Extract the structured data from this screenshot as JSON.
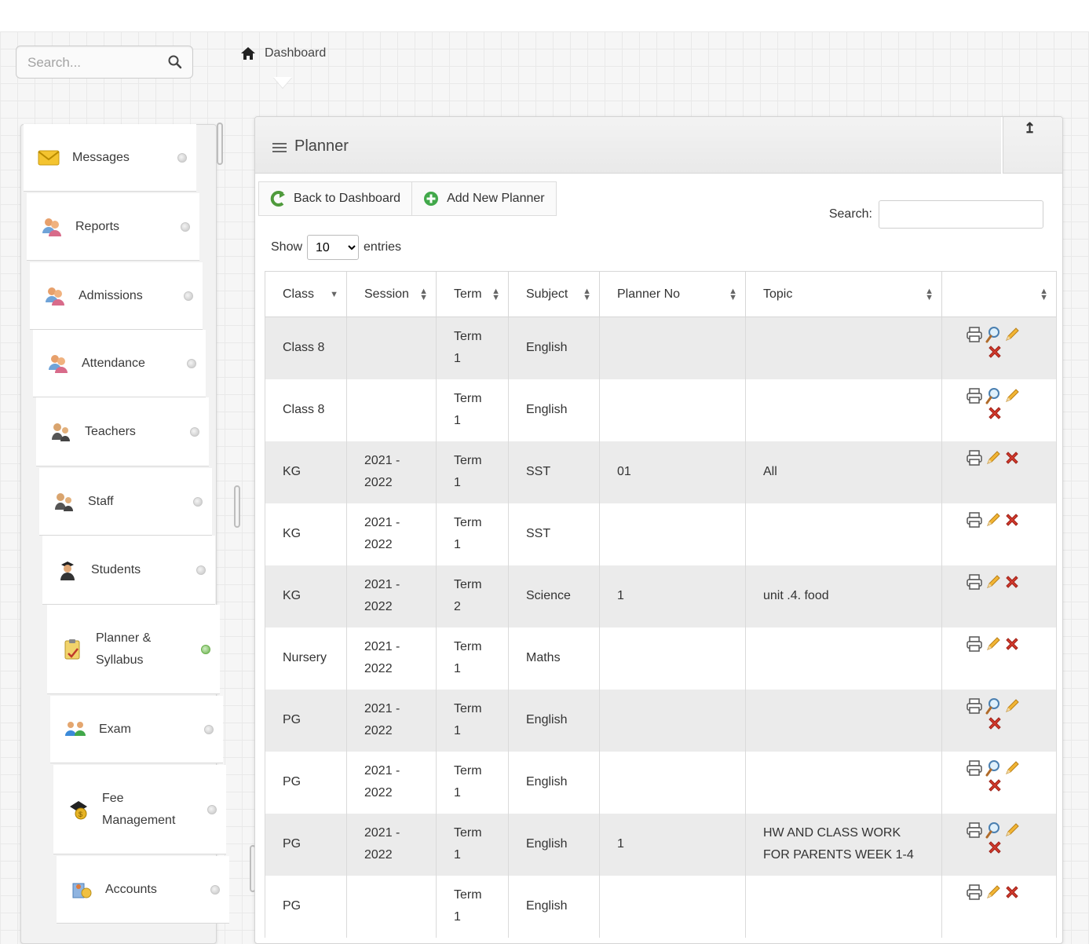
{
  "search": {
    "placeholder": "Search..."
  },
  "breadcrumb": {
    "label": "Dashboard"
  },
  "sidebar": {
    "items": [
      {
        "label": "Messages",
        "icon": "envelope-icon",
        "active": false
      },
      {
        "label": "Reports",
        "icon": "users-icon",
        "active": false
      },
      {
        "label": "Admissions",
        "icon": "users-icon",
        "active": false
      },
      {
        "label": "Attendance",
        "icon": "users-icon",
        "active": false
      },
      {
        "label": "Teachers",
        "icon": "teacher-icon",
        "active": false
      },
      {
        "label": "Staff",
        "icon": "teacher-icon",
        "active": false
      },
      {
        "label": "Students",
        "icon": "student-icon",
        "active": false
      },
      {
        "label": "Planner & Syllabus",
        "icon": "clipboard-icon",
        "active": true
      },
      {
        "label": "Exam",
        "icon": "group-icon",
        "active": false
      },
      {
        "label": "Fee Management",
        "icon": "money-icon",
        "active": false
      },
      {
        "label": "Accounts",
        "icon": "accounts-icon",
        "active": false
      }
    ]
  },
  "panel": {
    "title": "Planner",
    "back_label": "Back to Dashboard",
    "add_label": "Add New Planner",
    "show_label": "Show",
    "entries_label": "entries",
    "page_length": "10",
    "search_label": "Search:"
  },
  "table": {
    "columns": [
      "Class",
      "Session",
      "Term",
      "Subject",
      "Planner No",
      "Topic",
      ""
    ],
    "rows": [
      {
        "class": "Class 8",
        "session": "",
        "term": "Term 1",
        "subject": "English",
        "planner_no": "",
        "topic": "",
        "actions": [
          "print",
          "view",
          "edit",
          "delete"
        ]
      },
      {
        "class": "Class 8",
        "session": "",
        "term": "Term 1",
        "subject": "English",
        "planner_no": "",
        "topic": "",
        "actions": [
          "print",
          "view",
          "edit",
          "delete"
        ]
      },
      {
        "class": "KG",
        "session": "2021 - 2022",
        "term": "Term 1",
        "subject": "SST",
        "planner_no": "01",
        "topic": "All",
        "actions": [
          "print",
          "edit",
          "delete"
        ]
      },
      {
        "class": "KG",
        "session": "2021 - 2022",
        "term": "Term 1",
        "subject": "SST",
        "planner_no": "",
        "topic": "",
        "actions": [
          "print",
          "edit",
          "delete"
        ]
      },
      {
        "class": "KG",
        "session": "2021 - 2022",
        "term": "Term 2",
        "subject": "Science",
        "planner_no": "1",
        "topic": "unit .4. food",
        "actions": [
          "print",
          "edit",
          "delete"
        ]
      },
      {
        "class": "Nursery",
        "session": "2021 - 2022",
        "term": "Term 1",
        "subject": "Maths",
        "planner_no": "",
        "topic": "",
        "actions": [
          "print",
          "edit",
          "delete"
        ]
      },
      {
        "class": "PG",
        "session": "2021 - 2022",
        "term": "Term 1",
        "subject": "English",
        "planner_no": "",
        "topic": "",
        "actions": [
          "print",
          "view",
          "edit",
          "delete"
        ]
      },
      {
        "class": "PG",
        "session": "2021 - 2022",
        "term": "Term 1",
        "subject": "English",
        "planner_no": "",
        "topic": "",
        "actions": [
          "print",
          "view",
          "edit",
          "delete"
        ]
      },
      {
        "class": "PG",
        "session": "2021 - 2022",
        "term": "Term 1",
        "subject": "English",
        "planner_no": "1",
        "topic": "HW AND CLASS WORK FOR PARENTS WEEK 1-4",
        "actions": [
          "print",
          "view",
          "edit",
          "delete"
        ]
      },
      {
        "class": "PG",
        "session": "",
        "term": "Term 1",
        "subject": "English",
        "planner_no": "",
        "topic": "",
        "actions": [
          "print",
          "edit",
          "delete"
        ]
      }
    ]
  },
  "colors": {
    "accent_green": "#5cb85c",
    "delete_red": "#d33a2c",
    "edit_orange": "#e6a519"
  }
}
